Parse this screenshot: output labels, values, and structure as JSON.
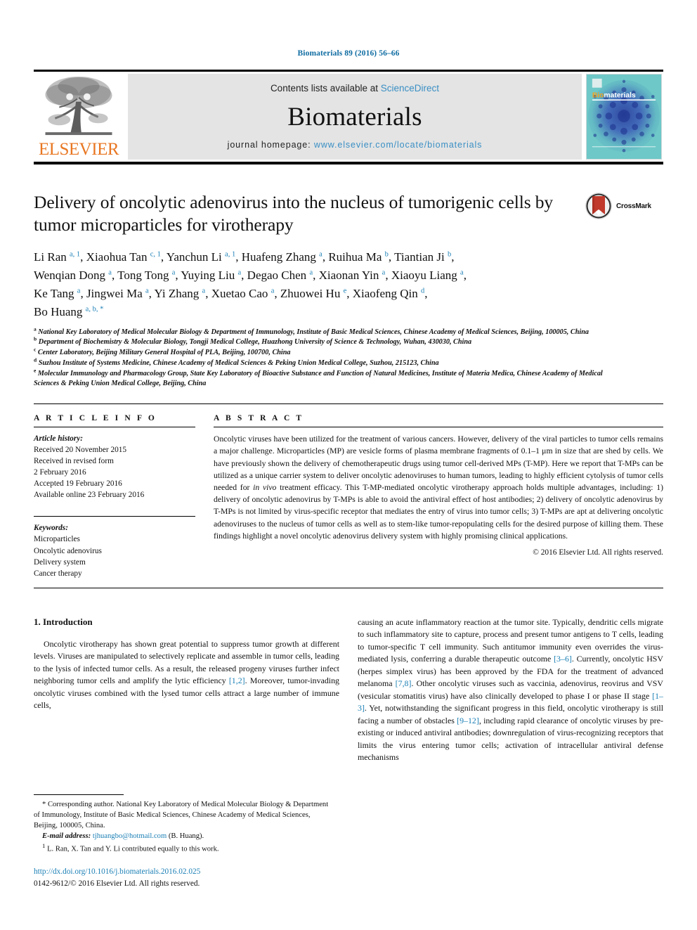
{
  "running_head": "Biomaterials 89 (2016) 56–66",
  "masthead": {
    "publisher_logo_text": "ELSEVIER",
    "contents_prefix": "Contents lists available at ",
    "contents_link": "ScienceDirect",
    "journal_name": "Biomaterials",
    "homepage_prefix": "journal homepage: ",
    "homepage_link": "www.elsevier.com/locate/biomaterials",
    "cover_title": "Biomaterials"
  },
  "crossmark": {
    "label": "CrossMark",
    "icon": "crossmark-icon"
  },
  "article": {
    "title": "Delivery of oncolytic adenovirus into the nucleus of tumorigenic cells by tumor microparticles for virotherapy",
    "authors_line1": "Li Ran <sup>a, 1</sup>, Xiaohua Tan <sup>c, 1</sup>, Yanchun Li <sup>a, 1</sup>, Huafeng Zhang <sup>a</sup>, Ruihua Ma <sup>b</sup>, Tiantian Ji <sup>b</sup>,",
    "authors_line2": "Wenqian Dong <sup>a</sup>, Tong Tong <sup>a</sup>, Yuying Liu <sup>a</sup>, Degao Chen <sup>a</sup>, Xiaonan Yin <sup>a</sup>, Xiaoyu Liang <sup>a</sup>,",
    "authors_line3": "Ke Tang <sup>a</sup>, Jingwei Ma <sup>a</sup>, Yi Zhang <sup>a</sup>, Xuetao Cao <sup>a</sup>, Zhuowei Hu <sup>e</sup>, Xiaofeng Qin <sup>d</sup>,",
    "authors_line4": "Bo Huang <sup>a, b, *</sup>"
  },
  "affiliations": [
    "<sup>a</sup> National Key Laboratory of Medical Molecular Biology &amp; Department of Immunology, Institute of Basic Medical Sciences, Chinese Academy of Medical Sciences, Beijing, 100005, China",
    "<sup>b</sup> Department of Biochemistry &amp; Molecular Biology, Tongji Medical College, Huazhong University of Science &amp; Technology, Wuhan, 430030, China",
    "<sup>c</sup> Center Laboratory, Beijing Military General Hospital of PLA, Beijing, 100700, China",
    "<sup>d</sup> Suzhou Institute of Systems Medicine, Chinese Academy of Medical Sciences &amp; Peking Union Medical College, Suzhou, 215123, China",
    "<sup>e</sup> Molecular Immunology and Pharmacology Group, State Key Laboratory of Bioactive Substance and Function of Natural Medicines, Institute of Materia Medica, Chinese Academy of Medical Sciences &amp; Peking Union Medical College, Beijing, China"
  ],
  "article_info": {
    "heading": "A R T I C L E  I N F O",
    "history_label": "Article history:",
    "history": [
      "Received 20 November 2015",
      "Received in revised form",
      "2 February 2016",
      "Accepted 19 February 2016",
      "Available online 23 February 2016"
    ],
    "keywords_label": "Keywords:",
    "keywords": [
      "Microparticles",
      "Oncolytic adenovirus",
      "Delivery system",
      "Cancer therapy"
    ]
  },
  "abstract": {
    "heading": "A B S T R A C T",
    "body": "Oncolytic viruses have been utilized for the treatment of various cancers. However, delivery of the viral particles to tumor cells remains a major challenge. Microparticles (MP) are vesicle forms of plasma membrane fragments of 0.1–1 μm in size that are shed by cells. We have previously shown the delivery of chemotherapeutic drugs using tumor cell-derived MPs (T-MP). Here we report that T-MPs can be utilized as a unique carrier system to deliver oncolytic adenoviruses to human tumors, leading to highly efficient cytolysis of tumor cells needed for <i>in vivo</i> treatment efficacy. This T-MP-mediated oncolytic virotherapy approach holds multiple advantages, including: 1) delivery of oncolytic adenovirus by T-MPs is able to avoid the antiviral effect of host antibodies; 2) delivery of oncolytic adenovirus by T-MPs is not limited by virus-specific receptor that mediates the entry of virus into tumor cells; 3) T-MPs are apt at delivering oncolytic adenoviruses to the nucleus of tumor cells as well as to stem-like tumor-repopulating cells for the desired purpose of killing them. These findings highlight a novel oncolytic adenovirus delivery system with highly promising clinical applications.",
    "copyright": "© 2016 Elsevier Ltd. All rights reserved."
  },
  "introduction": {
    "section_title": "1. Introduction",
    "left_paragraph": "Oncolytic virotherapy has shown great potential to suppress tumor growth at different levels. Viruses are manipulated to selectively replicate and assemble in tumor cells, leading to the lysis of infected tumor cells. As a result, the released progeny viruses further infect neighboring tumor cells and amplify the lytic efficiency <span class=\"ref\">[1,2]</span>. Moreover, tumor-invading oncolytic viruses combined with the lysed tumor cells attract a large number of immune cells,",
    "right_paragraph": "causing an acute inflammatory reaction at the tumor site. Typically, dendritic cells migrate to such inflammatory site to capture, process and present tumor antigens to T cells, leading to tumor-specific T cell immunity. Such antitumor immunity even overrides the virus-mediated lysis, conferring a durable therapeutic outcome <span class=\"ref\">[3–6]</span>. Currently, oncolytic HSV (herpes simplex virus) has been approved by the FDA for the treatment of advanced melanoma <span class=\"ref\">[7,8]</span>. Other oncolytic viruses such as vaccinia, adenovirus, reovirus and VSV (vesicular stomatitis virus) have also clinically developed to phase I or phase II stage <span class=\"ref\">[1–3]</span>. Yet, notwithstanding the significant progress in this field, oncolytic virotherapy is still facing a number of obstacles <span class=\"ref\">[9–12]</span>, including rapid clearance of oncolytic viruses by pre-existing or induced antiviral antibodies; downregulation of virus-recognizing receptors that limits the virus entering tumor cells; activation of intracellular antiviral defense mechanisms"
  },
  "footnotes": {
    "corresponding": "* Corresponding author. National Key Laboratory of Medical Molecular Biology &amp; Department of Immunology, Institute of Basic Medical Sciences, Chinese Academy of Medical Sciences, Beijing, 100005, China.",
    "email_label": "E-mail address:",
    "email": "tjhuangbo@hotmail.com",
    "email_suffix": "(B. Huang).",
    "equal_contribution": "<sup>1</sup> L. Ran, X. Tan and Y. Li contributed equally to this work.",
    "doi": "http://dx.doi.org/10.1016/j.biomaterials.2016.02.025",
    "issn": "0142-9612/© 2016 Elsevier Ltd. All rights reserved."
  },
  "colors": {
    "link_blue": "#1a7fb5",
    "header_blue": "#0f6ca2",
    "elsevier_orange": "#E87722",
    "masthead_gray": "#e4e4e4",
    "cover_teal": "#5fc3c6",
    "cover_dark_blue": "#1b2f8c"
  }
}
